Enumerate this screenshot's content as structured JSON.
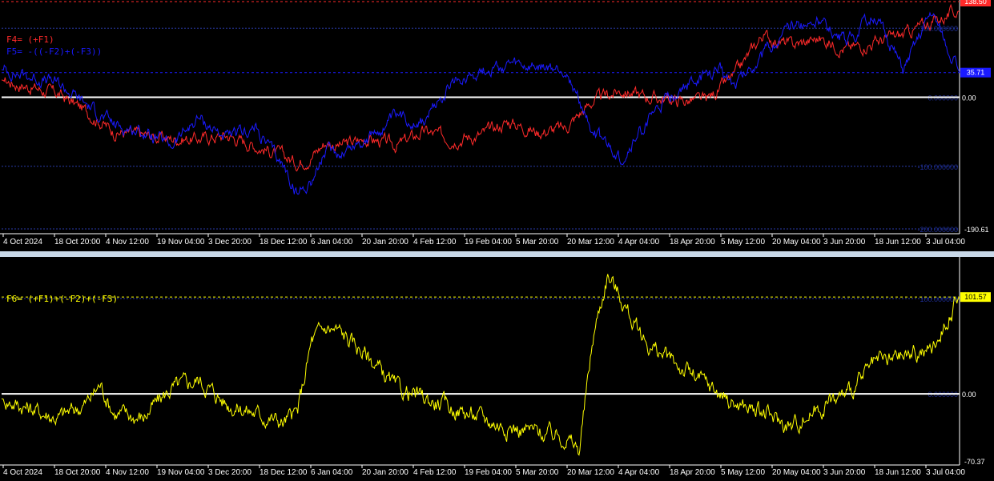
{
  "chart_data": [
    {
      "type": "line",
      "title": "",
      "x_ticks": [
        "4 Oct 2024",
        "18 Oct 20:00",
        "4 Nov 12:00",
        "19 Nov 04:00",
        "3 Dec 20:00",
        "18 Dec 12:00",
        "6 Jan 04:00",
        "20 Jan 20:00",
        "4 Feb 12:00",
        "19 Feb 04:00",
        "5 Mar 20:00",
        "20 Mar 12:00",
        "4 Apr 04:00",
        "18 Apr 20:00",
        "5 May 12:00",
        "20 May 04:00",
        "3 Jun 20:00",
        "18 Jun 12:00",
        "3 Jul 04:00"
      ],
      "ylim": [
        -190.61,
        138.5
      ],
      "levels": [
        {
          "value": 100,
          "label": "100.000000"
        },
        {
          "value": 0,
          "label": "0.000000"
        },
        {
          "value": -100,
          "label": "-100.000000"
        },
        {
          "value": -190.61,
          "label": "-200.000000"
        }
      ],
      "zero_label": "0.00",
      "min_label": "-190.61",
      "current_values": [
        {
          "series": "F4",
          "label": "138.50",
          "value": 138.5,
          "color": "#ff2a2a"
        },
        {
          "series": "F5",
          "label": "35.71",
          "value": 35.71,
          "color": "#1a1aff"
        }
      ],
      "series": [
        {
          "name": "F4= (+F1)",
          "color": "#ff2a2a",
          "x": [
            0,
            10,
            20,
            30,
            40,
            50,
            60,
            70,
            80,
            90,
            100,
            105,
            110,
            115,
            120,
            130,
            140,
            150,
            160,
            170,
            180,
            190,
            200,
            210,
            220,
            230,
            240,
            250,
            260,
            270,
            280,
            290,
            300,
            310,
            320,
            330,
            340
          ],
          "y": [
            25,
            15,
            5,
            -20,
            -50,
            -55,
            -60,
            -60,
            -55,
            -70,
            -85,
            -95,
            -85,
            -65,
            -70,
            -60,
            -70,
            -50,
            -60,
            -55,
            -35,
            -50,
            -45,
            -5,
            10,
            0,
            -5,
            -5,
            30,
            90,
            75,
            85,
            70,
            80,
            90,
            110,
            125
          ]
        },
        {
          "name": "F5= -((-F2)+(-F3))",
          "color": "#1a1aff",
          "x": [
            0,
            10,
            20,
            30,
            40,
            50,
            60,
            70,
            80,
            90,
            100,
            105,
            110,
            115,
            120,
            130,
            140,
            150,
            160,
            170,
            180,
            190,
            200,
            210,
            220,
            230,
            240,
            250,
            255,
            260,
            265,
            270,
            280,
            290,
            300,
            310,
            320,
            330,
            340
          ],
          "y": [
            40,
            30,
            20,
            -10,
            -40,
            -50,
            -70,
            -30,
            -60,
            -45,
            -100,
            -140,
            -120,
            -80,
            -80,
            -60,
            -30,
            -35,
            20,
            40,
            45,
            40,
            40,
            -50,
            -90,
            -30,
            10,
            30,
            40,
            20,
            40,
            60,
            100,
            110,
            80,
            120,
            40,
            125,
            36
          ]
        }
      ]
    },
    {
      "type": "line",
      "title": "",
      "x_ticks": [
        "4 Oct 2024",
        "18 Oct 20:00",
        "4 Nov 12:00",
        "19 Nov 04:00",
        "3 Dec 20:00",
        "18 Dec 12:00",
        "6 Jan 04:00",
        "20 Jan 20:00",
        "4 Feb 12:00",
        "19 Feb 04:00",
        "5 Mar 20:00",
        "20 Mar 12:00",
        "4 Apr 04:00",
        "18 Apr 20:00",
        "5 May 12:00",
        "20 May 04:00",
        "3 Jun 20:00",
        "18 Jun 12:00",
        "3 Jul 04:00"
      ],
      "ylim": [
        -70.37,
        142
      ],
      "levels": [
        {
          "value": 100,
          "label": "100.000000"
        },
        {
          "value": 0,
          "label": "0.000000"
        }
      ],
      "zero_label": "0.00",
      "min_label": "-70.37",
      "current_values": [
        {
          "series": "F6",
          "label": "101.57",
          "value": 101.57,
          "color": "#ffff00"
        }
      ],
      "series": [
        {
          "name": "F6= (+F1)+(-F2)+(-F3)",
          "color": "#ffff00",
          "x": [
            0,
            10,
            20,
            30,
            35,
            40,
            50,
            60,
            70,
            80,
            90,
            100,
            105,
            110,
            115,
            120,
            130,
            140,
            150,
            160,
            170,
            180,
            190,
            200,
            205,
            210,
            215,
            220,
            225,
            230,
            240,
            250,
            260,
            270,
            280,
            290,
            300,
            310,
            320,
            330,
            335,
            340
          ],
          "y": [
            -5,
            -15,
            -25,
            -10,
            10,
            -20,
            -25,
            5,
            15,
            -10,
            -20,
            -30,
            -20,
            55,
            70,
            65,
            40,
            5,
            -5,
            -15,
            -25,
            -35,
            -40,
            -45,
            -60,
            60,
            125,
            100,
            70,
            50,
            30,
            10,
            -10,
            -20,
            -35,
            -15,
            0,
            30,
            40,
            45,
            75,
            102
          ]
        }
      ]
    }
  ]
}
